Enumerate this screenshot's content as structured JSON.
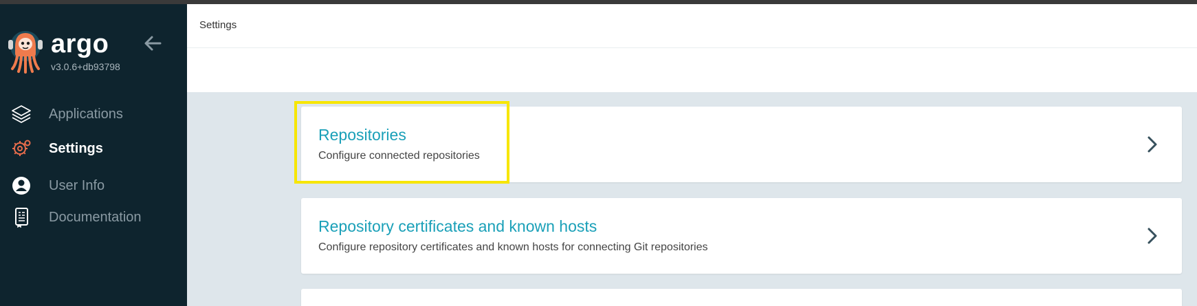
{
  "app": {
    "name": "argo",
    "version": "v3.0.6+db93798"
  },
  "sidebar": {
    "items": [
      {
        "label": "Applications",
        "icon": "layers-icon",
        "active": false
      },
      {
        "label": "Settings",
        "icon": "gear-icon",
        "active": true
      },
      {
        "label": "User Info",
        "icon": "user-circle-icon",
        "active": false
      },
      {
        "label": "Documentation",
        "icon": "book-icon",
        "active": false
      }
    ]
  },
  "header": {
    "breadcrumb": "Settings"
  },
  "cards": [
    {
      "title": "Repositories",
      "description": "Configure connected repositories",
      "highlighted": true
    },
    {
      "title": "Repository certificates and known hosts",
      "description": "Configure repository certificates and known hosts for connecting Git repositories"
    }
  ],
  "colors": {
    "sidebar_bg": "#0e242e",
    "accent_title": "#1aa0b8",
    "settings_icon": "#e96d4c",
    "highlight": "#f7e600",
    "content_bg": "#dee6eb"
  }
}
